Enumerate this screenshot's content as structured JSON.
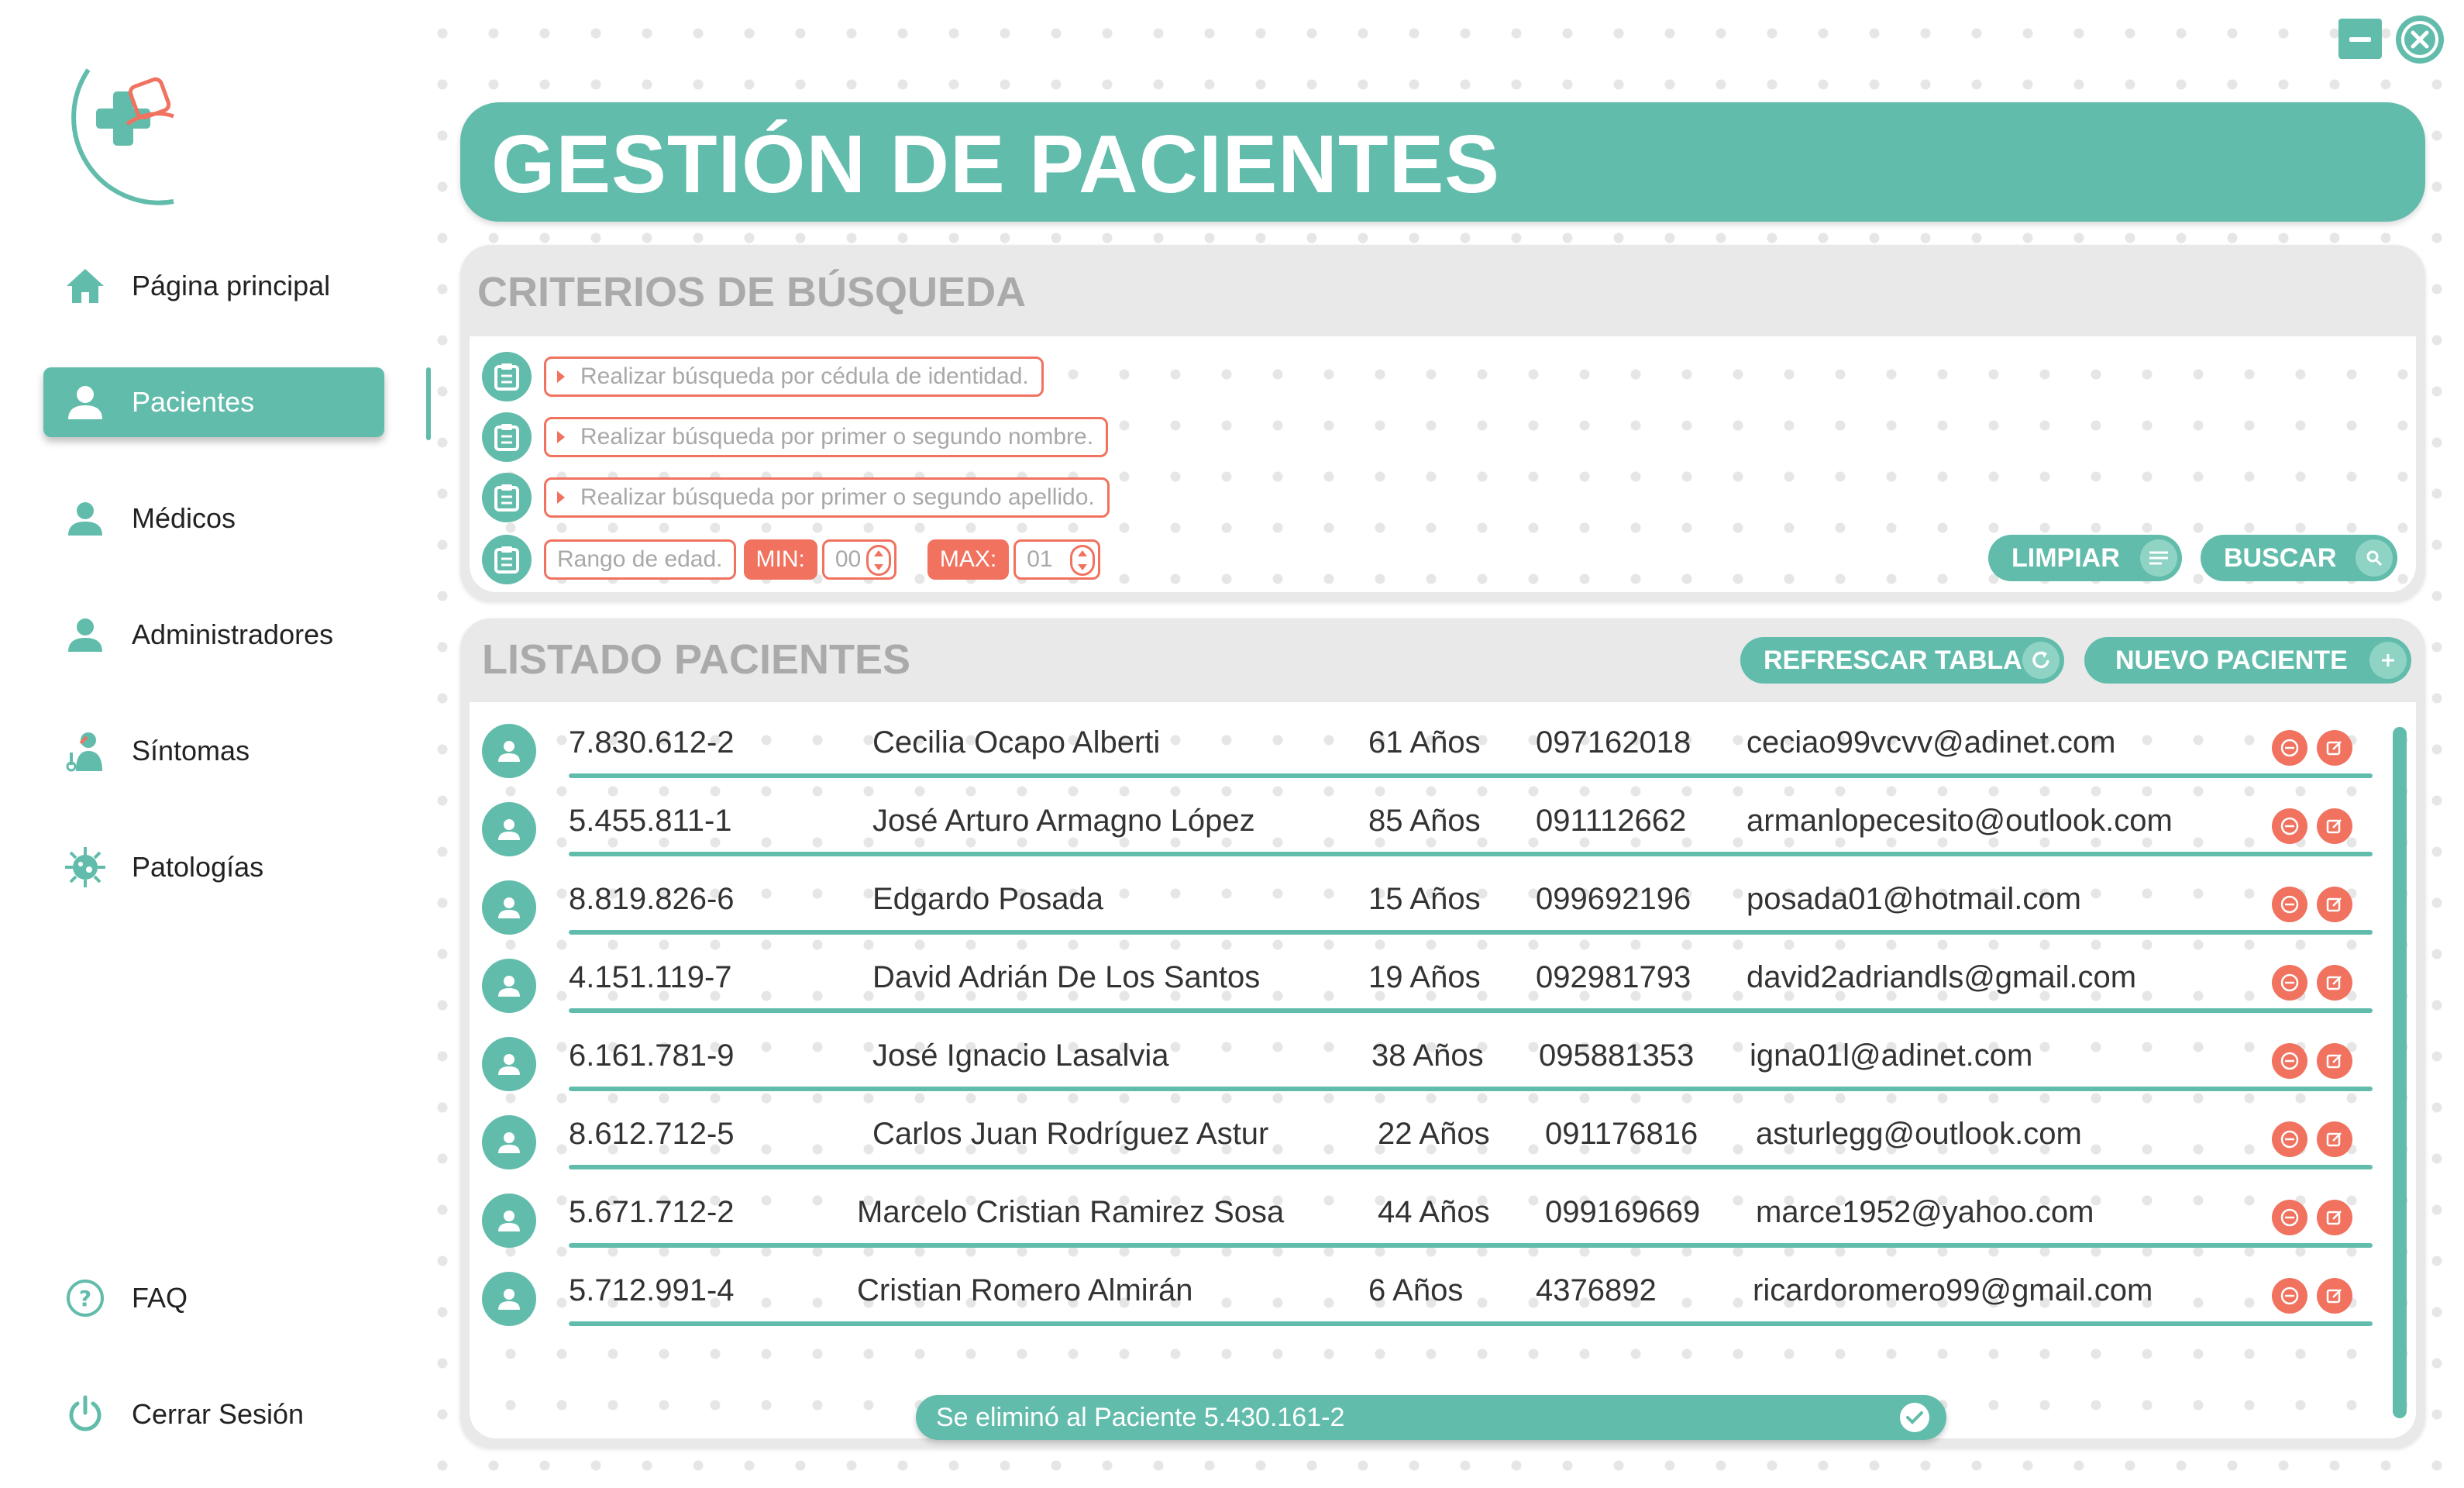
{
  "window": {
    "minimize_icon": "minimize-icon",
    "close_icon": "close-icon"
  },
  "sidebar": {
    "items": [
      {
        "label": "Página principal",
        "icon": "home-icon"
      },
      {
        "label": "Pacientes",
        "icon": "user-icon",
        "active": true
      },
      {
        "label": "Médicos",
        "icon": "user-icon"
      },
      {
        "label": "Administradores",
        "icon": "user-icon"
      },
      {
        "label": "Síntomas",
        "icon": "doctor-icon"
      },
      {
        "label": "Patologías",
        "icon": "virus-icon"
      }
    ],
    "footer": [
      {
        "label": "FAQ",
        "icon": "help-icon"
      },
      {
        "label": "Cerrar Sesión",
        "icon": "power-icon"
      }
    ]
  },
  "header": {
    "title": "GESTIÓN DE PACIENTES"
  },
  "criteria": {
    "title": "CRITERIOS DE BÚSQUEDA",
    "cedula_placeholder": "Realizar búsqueda por cédula de identidad.",
    "nombre_placeholder": "Realizar búsqueda por primer o segundo nombre.",
    "apellido_placeholder": "Realizar búsqueda por primer o segundo apellido.",
    "edad_label": "Rango de edad.",
    "min_label": "MIN:",
    "min_value": "00",
    "max_label": "MAX:",
    "max_value": "01",
    "clear_label": "LIMPIAR",
    "search_label": "BUSCAR"
  },
  "listing": {
    "title": "LISTADO PACIENTES",
    "refresh_label": "REFRESCAR TABLA",
    "new_label": "NUEVO PACIENTE",
    "rows": [
      {
        "ci": "7.830.612-2",
        "name": "Cecilia Ocapo Alberti",
        "age": "61 Años",
        "phone": "097162018",
        "email": "ceciao99vcvv@adinet.com"
      },
      {
        "ci": "5.455.811-1",
        "name": "José Arturo Armagno López",
        "age": "85 Años",
        "phone": "091112662",
        "email": "armanlopecesito@outlook.com"
      },
      {
        "ci": "8.819.826-6",
        "name": "Edgardo Posada",
        "age": "15 Años",
        "phone": "099692196",
        "email": "posada01@hotmail.com"
      },
      {
        "ci": "4.151.119-7",
        "name": "David Adrián De Los Santos",
        "age": "19 Años",
        "phone": "092981793",
        "email": "david2adriandls@gmail.com"
      },
      {
        "ci": "6.161.781-9",
        "name": "José Ignacio Lasalvia",
        "age": "38 Años",
        "phone": "095881353",
        "email": "igna01l@adinet.com"
      },
      {
        "ci": "8.612.712-5",
        "name": "Carlos Juan Rodríguez Astur",
        "age": "22 Años",
        "phone": "091176816",
        "email": "asturlegg@outlook.com"
      },
      {
        "ci": "5.671.712-2",
        "name": "Marcelo Cristian Ramirez Sosa",
        "age": "44 Años",
        "phone": "099169669",
        "email": "marce1952@yahoo.com"
      },
      {
        "ci": "5.712.991-4",
        "name": "Cristian Romero Almirán",
        "age": "6   Años",
        "phone": "4376892",
        "email": "ricardoromero99@gmail.com"
      }
    ]
  },
  "toast": {
    "message": "Se eliminó al Paciente 5.430.161-2"
  },
  "colors": {
    "accent": "#62bcab",
    "danger": "#f0725f",
    "panel": "#e9e9e9"
  }
}
